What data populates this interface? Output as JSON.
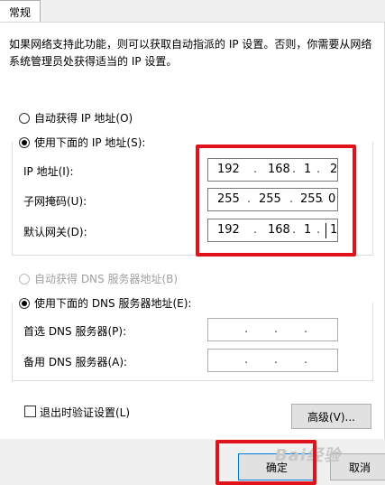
{
  "tab": {
    "label": "常规"
  },
  "description": "如果网络支持此功能，则可以获取自动指派的 IP 设置。否则，你需要从网络系统管理员处获得适当的 IP 设置。",
  "ip_section": {
    "auto_label": "自动获得 IP 地址(O)",
    "manual_label": "使用下面的 IP 地址(S):",
    "fields": [
      {
        "label": "IP 地址(I):",
        "octets": [
          "192",
          "168",
          "1",
          "2"
        ]
      },
      {
        "label": "子网掩码(U):",
        "octets": [
          "255",
          "255",
          "255",
          "0"
        ]
      },
      {
        "label": "默认网关(D):",
        "octets": [
          "192",
          "168",
          "1",
          "1"
        ]
      }
    ]
  },
  "dns_section": {
    "auto_label": "自动获得 DNS 服务器地址(B)",
    "manual_label": "使用下面的 DNS 服务器地址(E):",
    "fields": [
      {
        "label": "首选 DNS 服务器(P):"
      },
      {
        "label": "备用 DNS 服务器(A):"
      }
    ]
  },
  "validate_label": "退出时验证设置(L)",
  "advanced_button": "高级(V)...",
  "ok_button": "确定",
  "cancel_button": "取消",
  "watermark": "Bai经验",
  "colors": {
    "highlight": "#e2121a",
    "focus": "#0078d7"
  }
}
